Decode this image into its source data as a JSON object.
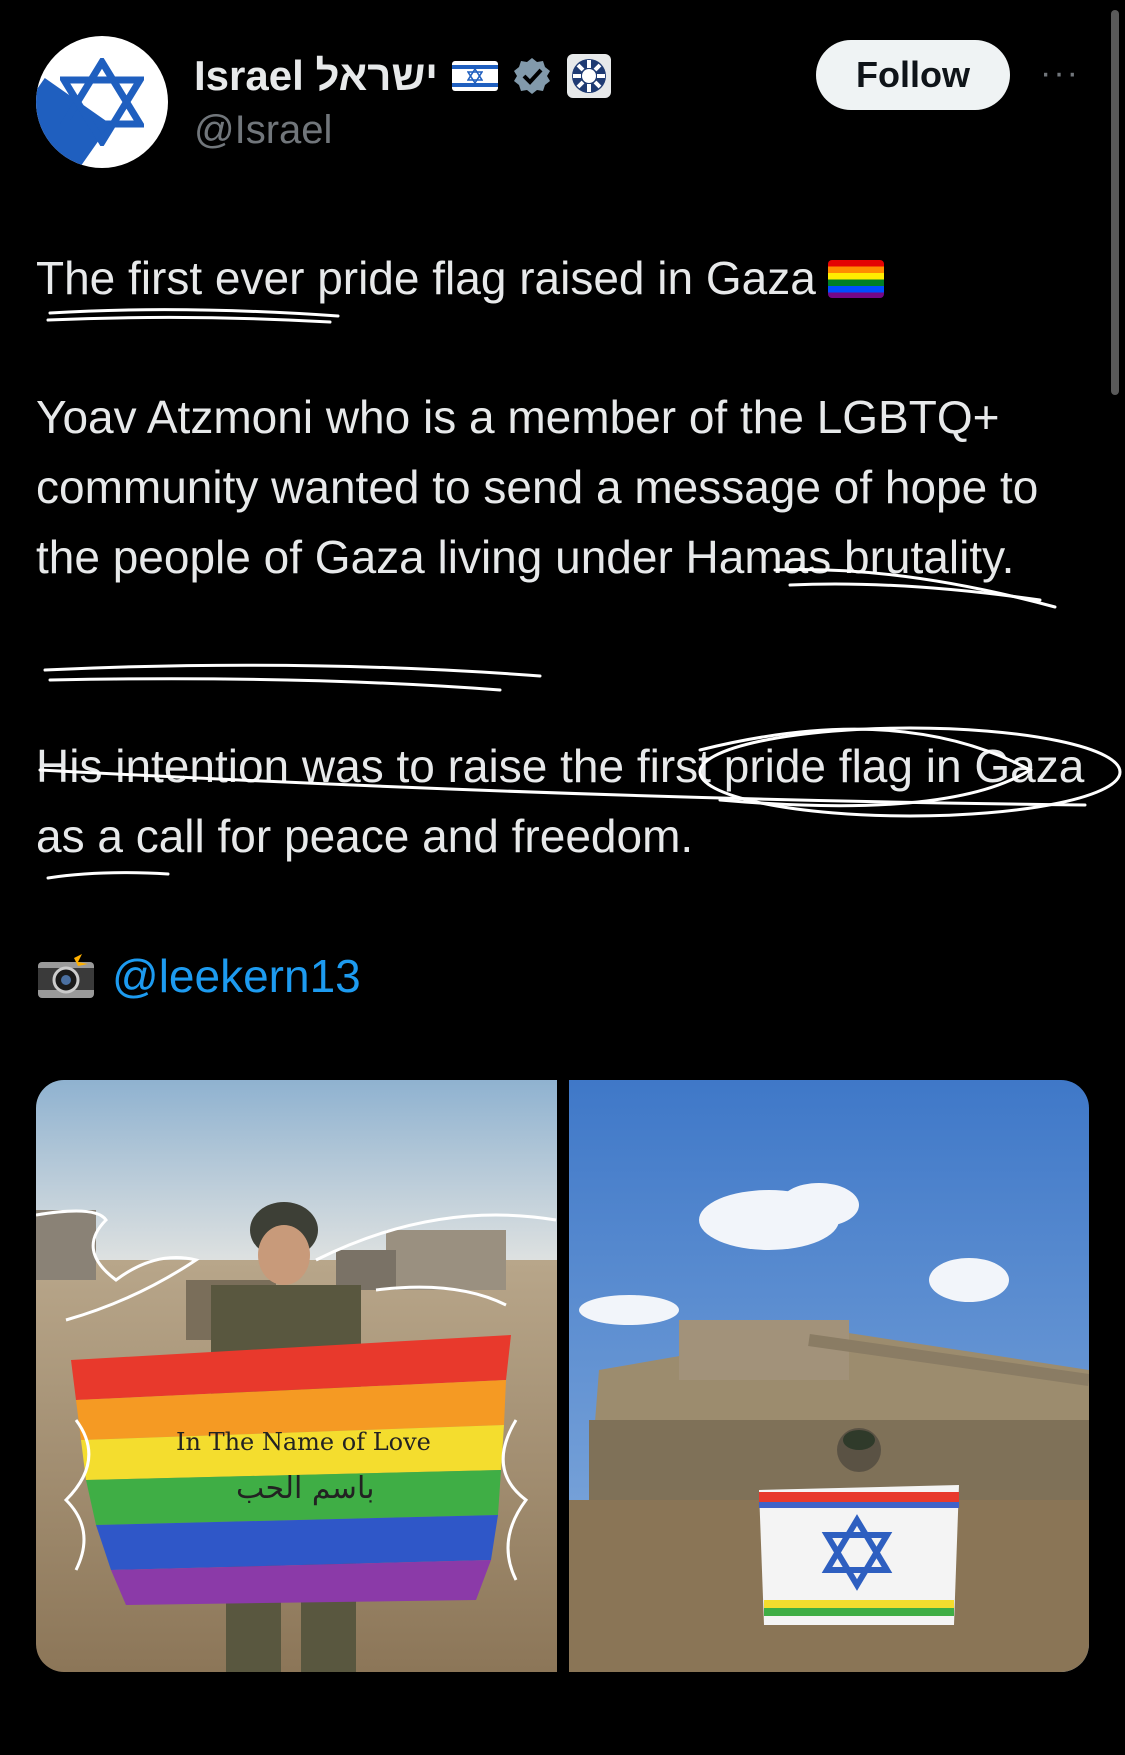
{
  "header": {
    "display_name": "Israel ישראל",
    "handle": "@Israel",
    "follow_label": "Follow",
    "more_label": "···"
  },
  "tweet": {
    "line1": "The first ever pride flag raised in Gaza",
    "para2": "Yoav Atzmoni who is a member of the LGBTQ+ community wanted to send a message of hope to the people of Gaza living under Hamas brutality.",
    "para3": "His intention was to raise the first pride flag in Gaza as a call for peace and freedom.",
    "mention": "@leekern13"
  },
  "media": {
    "photo1_flag_text": "In The Name of Love",
    "photo1_arabic_text": "باسم الحب"
  },
  "colors": {
    "background": "#000000",
    "text": "#e7e9ea",
    "muted": "#71767b",
    "link": "#1d9bf0",
    "verified": "#829aab"
  }
}
